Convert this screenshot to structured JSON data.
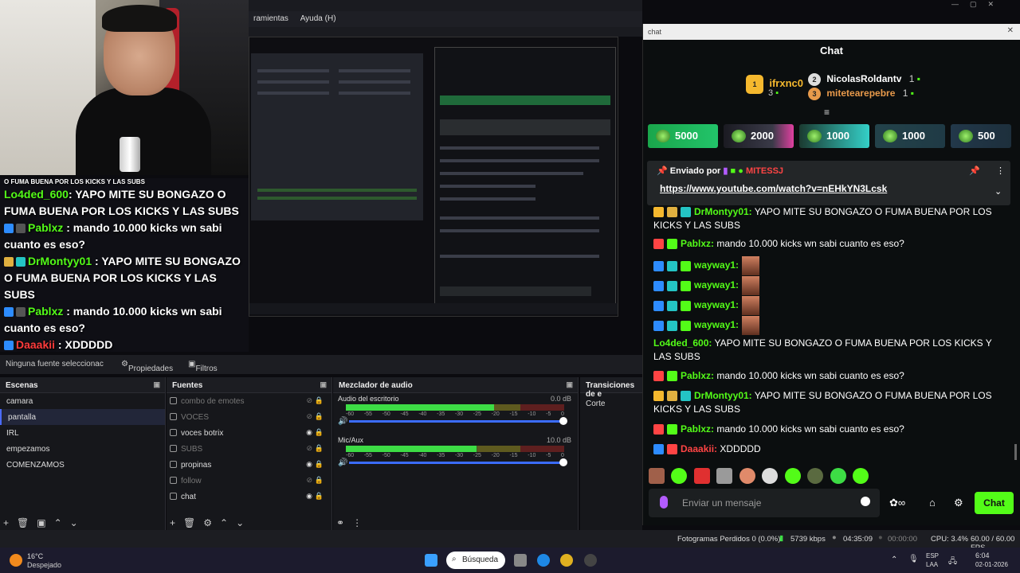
{
  "obs": {
    "menu": [
      "ramientas",
      "Ayuda (H)"
    ],
    "no_source": "Ninguna fuente seleccionac",
    "properties_tab": "Propiedades",
    "filters_tab": "Filtros",
    "scenes_title": "Escenas",
    "scenes": [
      "camara",
      "pantalla",
      "IRL",
      "empezamos",
      "COMENZAMOS"
    ],
    "sources_title": "Fuentes",
    "sources": [
      {
        "name": "combo de emotes",
        "visible": false
      },
      {
        "name": "VOCES",
        "visible": false
      },
      {
        "name": "voces botrix",
        "visible": true
      },
      {
        "name": "SUBS",
        "visible": false
      },
      {
        "name": "propinas",
        "visible": true
      },
      {
        "name": "follow",
        "visible": false
      },
      {
        "name": "chat",
        "visible": true
      }
    ],
    "mixer_title": "Mezclador de audio",
    "mixer": [
      {
        "name": "Audio del escritorio",
        "db": "0.0 dB",
        "level": 0.68
      },
      {
        "name": "Mic/Aux",
        "db": "10.0 dB",
        "level": 0.6
      }
    ],
    "scale": [
      "-60",
      "-55",
      "-50",
      "-45",
      "-40",
      "-35",
      "-30",
      "-25",
      "-20",
      "-15",
      "-10",
      "-5",
      "0"
    ],
    "transitions_title": "Transiciones de e",
    "transition_value": "Corte",
    "status": {
      "dropped": "Fotogramas Perdidos 0 (0.0%)",
      "kbps": "5739 kbps",
      "live_time": "04:35:09",
      "rec_time": "00:00:00",
      "cpu": "CPU: 3.4%",
      "fps": "60.00 / 60.00 FPS"
    }
  },
  "overlay": {
    "title_line": "O FUMA BUENA POR LOS KICKS Y LAS SUBS",
    "lines": [
      {
        "user": "Lo4ded_600",
        "text": ": YAPO MITE SU BONGAZO O"
      },
      {
        "user": "",
        "text": "FUMA BUENA POR LOS KICKS Y LAS SUBS"
      },
      {
        "user": "Pablxz",
        "text": " : mando 10.000 kicks wn sabi"
      },
      {
        "user": "",
        "text": "cuanto es eso?"
      },
      {
        "user": "DrMontyy01",
        "text": " : YAPO MITE SU BONGAZO"
      },
      {
        "user": "",
        "text": "O FUMA BUENA POR LOS KICKS Y LAS SUBS"
      },
      {
        "user": "Pablxz",
        "text": " : mando 10.000 kicks wn sabi"
      },
      {
        "user": "",
        "text": "cuanto es eso?"
      },
      {
        "user": "Daaakii",
        "text": " : XDDDDD"
      }
    ]
  },
  "chat": {
    "window_title": "chat",
    "header": "Chat",
    "podium": {
      "first": {
        "name": "ifrxnc0",
        "count": "3"
      },
      "second": {
        "name": "NicolasRoldantv",
        "count": "1"
      },
      "third": {
        "name": "mitetearepebre",
        "count": "1"
      }
    },
    "gifts": [
      "5000",
      "2000",
      "1000",
      "1000",
      "500"
    ],
    "pinned": {
      "label": "Enviado por",
      "user": "MITESSJ",
      "link": "https://www.youtube.com/watch?v=nEHkYN3Lcsk"
    },
    "messages": [
      {
        "user": "DrMontyy01:",
        "text": " YAPO MITE SU BONGAZO O FUMA BUENA POR LOS KICKS Y LAS SUBS"
      },
      {
        "user": "Pablxz:",
        "text": " mando 10.000 kicks wn sabi cuanto es eso?"
      },
      {
        "user": "wayway1:",
        "text": ""
      },
      {
        "user": "wayway1:",
        "text": ""
      },
      {
        "user": "wayway1:",
        "text": ""
      },
      {
        "user": "wayway1:",
        "text": ""
      },
      {
        "user": "Lo4ded_600:",
        "text": " YAPO MITE SU BONGAZO O FUMA BUENA POR LOS KICKS Y LAS SUBS"
      },
      {
        "user": "Pablxz:",
        "text": " mando 10.000 kicks wn sabi cuanto es eso?"
      },
      {
        "user": "DrMontyy01:",
        "text": " YAPO MITE SU BONGAZO O FUMA BUENA POR LOS KICKS Y LAS SUBS"
      },
      {
        "user": "Pablxz:",
        "text": " mando 10.000 kicks wn sabi cuanto es eso?"
      },
      {
        "user": "Daaakii:",
        "text": " XDDDDD"
      }
    ],
    "input_placeholder": "Enviar un mensaje",
    "send_label": "Chat"
  },
  "taskbar": {
    "weather_temp": "16°C",
    "weather_desc": "Despejado",
    "search_label": "Búsqueda",
    "lang1": "ESP",
    "lang2": "LAA",
    "time": "6:04",
    "date": "02-01-2026"
  },
  "colors": {
    "kick_green": "#53fc18",
    "accent_blue": "#3b6cff"
  }
}
